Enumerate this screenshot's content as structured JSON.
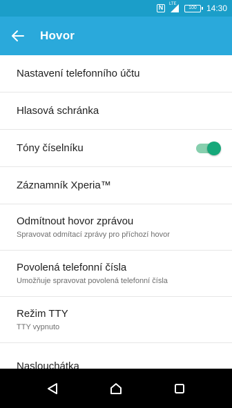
{
  "status_bar": {
    "nfc": "N",
    "network": "LTE",
    "battery": "100",
    "time": "14:30"
  },
  "app_bar": {
    "title": "Hovor"
  },
  "settings": [
    {
      "title": "Nastavení telefonního účtu",
      "subtitle": ""
    },
    {
      "title": "Hlasová schránka",
      "subtitle": ""
    },
    {
      "title": "Tóny číselníku",
      "subtitle": "",
      "toggle": true,
      "toggle_on": true
    },
    {
      "title": "Záznamník Xperia™",
      "subtitle": ""
    },
    {
      "title": "Odmítnout hovor zprávou",
      "subtitle": "Spravovat odmítací zprávy pro příchozí hovor"
    },
    {
      "title": "Povolená telefonní čísla",
      "subtitle": "Umožňuje spravovat povolená telefonní čísla"
    },
    {
      "title": "Režim TTY",
      "subtitle": "TTY vypnuto"
    },
    {
      "title": "Naslouchátka",
      "subtitle": ""
    }
  ],
  "colors": {
    "status_bar": "#1b9ec9",
    "app_bar": "#2aa9db",
    "toggle_on": "#16a87a",
    "nav_bar": "#000000"
  },
  "icons": {
    "back": "arrow-left-icon",
    "nav_back": "triangle-back-icon",
    "nav_home": "home-icon",
    "nav_recents": "square-recents-icon"
  }
}
